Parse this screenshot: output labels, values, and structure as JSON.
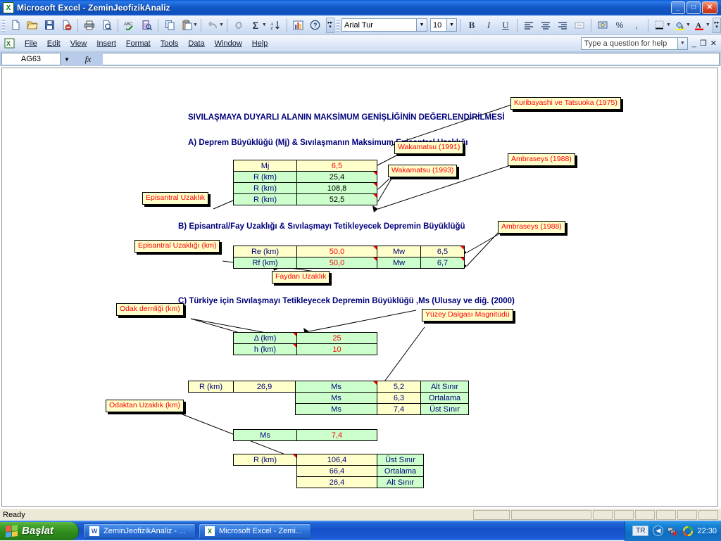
{
  "window": {
    "title": "Microsoft Excel - ZeminJeofizikAnaliz",
    "app_icon": "excel-icon",
    "minimize": "_",
    "maximize": "□",
    "close": "✕"
  },
  "toolbar": {
    "buttons": [
      {
        "name": "new-document",
        "glyph": "🗋"
      },
      {
        "name": "open-file",
        "glyph": "🗁"
      },
      {
        "name": "save",
        "glyph": "💾"
      },
      {
        "name": "permission",
        "glyph": "🗎"
      },
      {
        "name": "print",
        "glyph": "🖨"
      },
      {
        "name": "print-preview",
        "glyph": "🔍"
      },
      {
        "name": "spelling-check",
        "glyph": "ABC"
      },
      {
        "name": "research",
        "glyph": "📖"
      },
      {
        "name": "copy",
        "glyph": "📋"
      },
      {
        "name": "paste",
        "glyph": "📌"
      },
      {
        "name": "undo",
        "glyph": "↺"
      },
      {
        "name": "hyperlink",
        "glyph": "🔗"
      },
      {
        "name": "autosum",
        "glyph": "Σ"
      },
      {
        "name": "sort-ascending",
        "glyph": "A↓"
      },
      {
        "name": "chart-wizard",
        "glyph": "📊"
      },
      {
        "name": "help",
        "glyph": "?"
      }
    ],
    "font_name": "Arial Tur",
    "font_size": "10",
    "bold": "B",
    "italic": "I",
    "underline": "U",
    "align_left": "≡",
    "align_center": "≡",
    "align_right": "≡",
    "merge_cells": "⊞",
    "currency": "💱",
    "percent": "%",
    "comma": ",",
    "borders": "▦",
    "fill_color": "A",
    "font_color": "A"
  },
  "menubar": {
    "items": [
      {
        "name": "menu-file",
        "label": "File",
        "accel": "F"
      },
      {
        "name": "menu-edit",
        "label": "Edit",
        "accel": "E"
      },
      {
        "name": "menu-view",
        "label": "View",
        "accel": "V"
      },
      {
        "name": "menu-insert",
        "label": "Insert",
        "accel": "I"
      },
      {
        "name": "menu-format",
        "label": "Format",
        "accel": "o"
      },
      {
        "name": "menu-tools",
        "label": "Tools",
        "accel": "T"
      },
      {
        "name": "menu-data",
        "label": "Data",
        "accel": "D"
      },
      {
        "name": "menu-window",
        "label": "Window",
        "accel": "W"
      },
      {
        "name": "menu-help",
        "label": "Help",
        "accel": "H"
      }
    ],
    "ask_placeholder": "Type a question for help",
    "doc_minimize": "_",
    "doc_restore": "❐",
    "doc_close": "✕"
  },
  "formula_bar": {
    "name_box": "AG63",
    "formula_value": ""
  },
  "sheet": {
    "main_title": "SIVILAŞMAYA DUYARLI ALANIN MAKSİMUM GENİŞLİĞİNİN DEĞERLENDİRİLMESİ",
    "section_a_title": "A) Deprem Büyüklüğü (Mj) & Sıvılaşmanın Maksimum Episantral Uzaklığı",
    "section_b_title": "B) Episantral/Fay Uzaklığı & Sıvılaşmayı Tetikleyecek Depremin Büyüklüğü",
    "section_c_title": "C) Türkiye için Sıvılaşmayı Tetikleyecek Depremin Büyüklüğü ,Ms (Ulusay ve diğ. (2000)",
    "table_a": [
      {
        "label": "Mj",
        "value": "6,5",
        "label_fill": "yellow",
        "value_fill": "yellow",
        "value_color": "red",
        "comment": false
      },
      {
        "label": "R (km)",
        "value": "25,4",
        "label_fill": "green",
        "value_fill": "green",
        "value_color": "black",
        "comment": true
      },
      {
        "label": "R (km)",
        "value": "108,8",
        "label_fill": "green",
        "value_fill": "green",
        "value_color": "black",
        "comment": true
      },
      {
        "label": "R (km)",
        "value": "52,5",
        "label_fill": "green",
        "value_fill": "green",
        "value_color": "black",
        "comment": true
      }
    ],
    "table_b": [
      {
        "label": "Re (km)",
        "value": "50,0",
        "mw_label": "Mw",
        "mw_value": "6,5",
        "fill": "yellow",
        "value_color": "red"
      },
      {
        "label": "Rf (km)",
        "value": "50,0",
        "mw_label": "Mw",
        "mw_value": "6,7",
        "fill": "green",
        "value_color": "red"
      }
    ],
    "table_c": [
      {
        "label": "Δ (km)",
        "value": "25",
        "fill": "green",
        "value_color": "red"
      },
      {
        "label": "h (km)",
        "value": "10",
        "fill": "green",
        "value_color": "red"
      }
    ],
    "table_ms": {
      "r_label": "R (km)",
      "r_value": "26,9",
      "rows": [
        {
          "ms_label": "Ms",
          "ms_value": "5,2",
          "bound": "Alt Sınır"
        },
        {
          "ms_label": "Ms",
          "ms_value": "6,3",
          "bound": "Ortalama"
        },
        {
          "ms_label": "Ms",
          "ms_value": "7,4",
          "bound": "Üst Sınır"
        }
      ]
    },
    "table_ms_single": {
      "label": "Ms",
      "value": "7,4"
    },
    "table_r_final": {
      "label": "R (km)",
      "rows": [
        {
          "value": "106,4",
          "bound": "Üst Sınır"
        },
        {
          "value": "66,4",
          "bound": "Ortalama"
        },
        {
          "value": "26,4",
          "bound": "Alt Sınır"
        }
      ]
    },
    "notes": [
      {
        "id": "note-kuribayashi",
        "text": "Kuribayashi ve Tatsuoka (1975)"
      },
      {
        "id": "note-wakamatsu-1991",
        "text": "Wakamatsu (1991)"
      },
      {
        "id": "note-wakamatsu-1993",
        "text": "Wakamatsu (1993)"
      },
      {
        "id": "note-ambraseys-1988-a",
        "text": "Ambraseys (1988)"
      },
      {
        "id": "note-ambraseys-1988-b",
        "text": "Ambraseys (1988)"
      },
      {
        "id": "note-episantral-uzaklik",
        "text": "Episantral Uzaklık"
      },
      {
        "id": "note-episantral-uzakligi-km",
        "text": "Episantral Uzaklığı (km)"
      },
      {
        "id": "note-faydan-uzaklik",
        "text": "Faydan Uzaklık"
      },
      {
        "id": "note-odak-dernligi",
        "text": "Odak dernliği (km)"
      },
      {
        "id": "note-yuzey-dalgasi",
        "text": "Yüzey Dalgası Magnitüdü"
      },
      {
        "id": "note-odaktan-uzaklik",
        "text": "Odaktan Uzaklık (km)"
      }
    ]
  },
  "statusbar": {
    "status": "Ready"
  },
  "taskbar": {
    "start_label": "Başlat",
    "items": [
      {
        "name": "taskbar-item-word",
        "label": "ZeminJeofizikAnaliz - ...",
        "icon": "word-icon",
        "icon_letter": "W"
      },
      {
        "name": "taskbar-item-excel",
        "label": "Microsoft Excel - Zemi...",
        "icon": "excel-icon",
        "icon_letter": "X"
      }
    ],
    "tray": {
      "language": "TR",
      "clock": "22:30"
    }
  },
  "colors": {
    "title_blue": "#00007a",
    "note_red": "#ff0000",
    "cell_yellow": "#ffffcc",
    "cell_green": "#ccffcc",
    "taskbar_blue": "#1450c8",
    "start_green": "#2f8d1d"
  }
}
